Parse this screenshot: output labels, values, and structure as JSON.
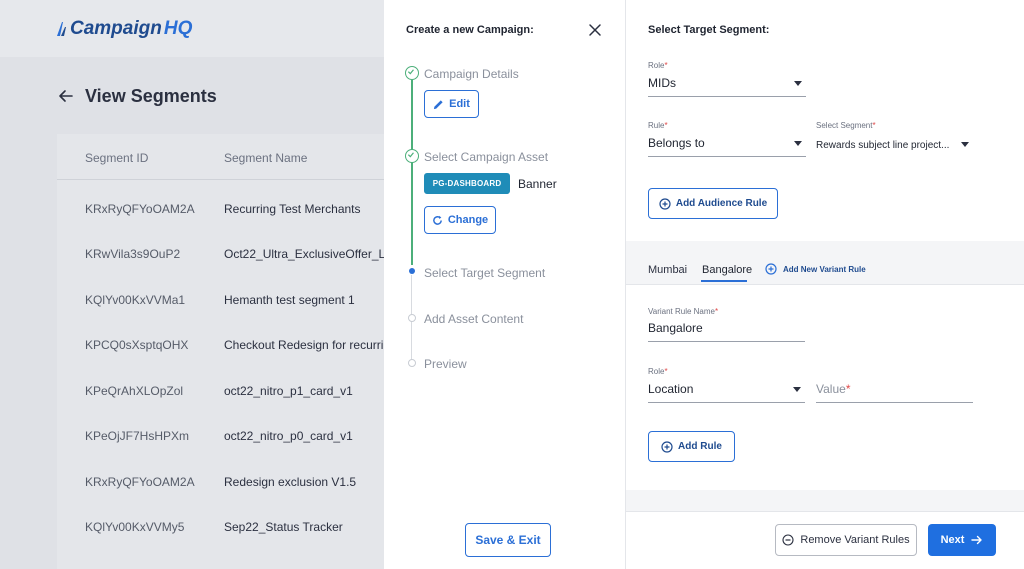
{
  "colors": {
    "accent": "#2b6fd6",
    "success": "#4caf7a",
    "primary_button": "#1f6fe0",
    "chip": "#1f8cb8",
    "brand": "#1f4b8f"
  },
  "app": {
    "logo_part1": "Campaign",
    "logo_part2": "HQ"
  },
  "background": {
    "title": "View Segments",
    "columns": [
      "Segment ID",
      "Segment Name"
    ],
    "rows": [
      {
        "id": "KRxRyQFYoOAM2A",
        "name": "Recurring Test Merchants"
      },
      {
        "id": "KRwVila3s9OuP2",
        "name": "Oct22_Ultra_ExclusiveOffer_LC"
      },
      {
        "id": "KQlYv00KxVVMa1",
        "name": "Hemanth test segment 1"
      },
      {
        "id": "KPCQ0sXsptqOHX",
        "name": "Checkout Redesign for recurring"
      },
      {
        "id": "KPeQrAhXLOpZol",
        "name": "oct22_nitro_p1_card_v1"
      },
      {
        "id": "KPeOjJF7HsHPXm",
        "name": "oct22_nitro_p0_card_v1"
      },
      {
        "id": "KRxRyQFYoOAM2A",
        "name": "Redesign exclusion V1.5"
      },
      {
        "id": "KQlYv00KxVVMy5",
        "name": "Sep22_Status Tracker"
      }
    ]
  },
  "wizard": {
    "title": "Create a new Campaign:",
    "steps": [
      {
        "label": "Campaign Details",
        "state": "done"
      },
      {
        "label": "Select Campaign Asset",
        "state": "done"
      },
      {
        "label": "Select Target Segment",
        "state": "current"
      },
      {
        "label": "Add Asset Content",
        "state": "todo"
      },
      {
        "label": "Preview",
        "state": "todo"
      }
    ],
    "edit_label": "Edit",
    "asset_chip": "PG-DASHBOARD",
    "asset_type": "Banner",
    "change_label": "Change",
    "save_exit_label": "Save & Exit"
  },
  "target": {
    "title": "Select Target Segment:",
    "role_label": "Role",
    "role_value": "MIDs",
    "rule_label": "Rule",
    "rule_value": "Belongs to",
    "segment_label": "Select Segment",
    "segment_value": "Rewards subject line project...",
    "add_audience_label": "Add Audience Rule",
    "tabs": [
      "Mumbai",
      "Bangalore"
    ],
    "active_tab": "Bangalore",
    "add_variant_label": "Add New Variant Rule",
    "variant_name_label": "Variant Rule Name",
    "variant_name_value": "Bangalore",
    "variant_role_label": "Role",
    "variant_role_value": "Location",
    "value_placeholder": "Value",
    "add_rule_label": "Add Rule",
    "remove_variant_label": "Remove Variant Rules",
    "next_label": "Next"
  }
}
